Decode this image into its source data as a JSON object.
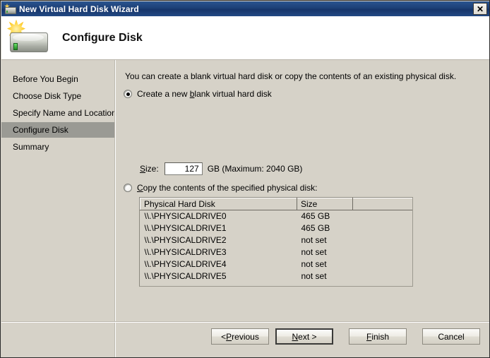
{
  "window": {
    "title": "New Virtual Hard Disk Wizard",
    "title_icon": "hard-disk-icon",
    "close_label": "✕"
  },
  "header": {
    "title": "Configure Disk",
    "icon": "hard-disk-new-icon"
  },
  "sidebar": {
    "items": [
      {
        "label": "Before You Begin",
        "selected": false
      },
      {
        "label": "Choose Disk Type",
        "selected": false
      },
      {
        "label": "Specify Name and Location",
        "selected": false
      },
      {
        "label": "Configure Disk",
        "selected": true
      },
      {
        "label": "Summary",
        "selected": false
      }
    ]
  },
  "main": {
    "description": "You can create a blank virtual hard disk or copy the contents of an existing physical disk.",
    "option_blank": {
      "label_before": "Create a new ",
      "label_accel": "b",
      "label_after": "lank virtual hard disk",
      "checked": true
    },
    "size_field": {
      "label_accel": "S",
      "label_after": "ize:",
      "value": "127",
      "suffix": "GB (Maximum: 2040 GB)"
    },
    "option_copy": {
      "label_accel": "C",
      "label_after": "opy the contents of the specified physical disk:",
      "checked": false
    },
    "table": {
      "columns": [
        "Physical Hard Disk",
        "Size",
        ""
      ],
      "rows": [
        {
          "name": "\\\\.\\PHYSICALDRIVE0",
          "size": "465 GB"
        },
        {
          "name": "\\\\.\\PHYSICALDRIVE1",
          "size": "465 GB"
        },
        {
          "name": "\\\\.\\PHYSICALDRIVE2",
          "size": "not set"
        },
        {
          "name": "\\\\.\\PHYSICALDRIVE3",
          "size": "not set"
        },
        {
          "name": "\\\\.\\PHYSICALDRIVE4",
          "size": "not set"
        },
        {
          "name": "\\\\.\\PHYSICALDRIVE5",
          "size": "not set"
        }
      ]
    }
  },
  "buttons": {
    "previous": {
      "prefix": "< ",
      "accel": "P",
      "suffix": "revious"
    },
    "next": {
      "accel": "N",
      "suffix": "ext >"
    },
    "finish": {
      "accel": "F",
      "suffix": "inish"
    },
    "cancel": {
      "label": "Cancel"
    }
  },
  "colors": {
    "dialog_bg": "#d6d2c8",
    "titlebar": "#1d4076",
    "selection": "#9a9a94",
    "header_bg": "#ffffff"
  }
}
